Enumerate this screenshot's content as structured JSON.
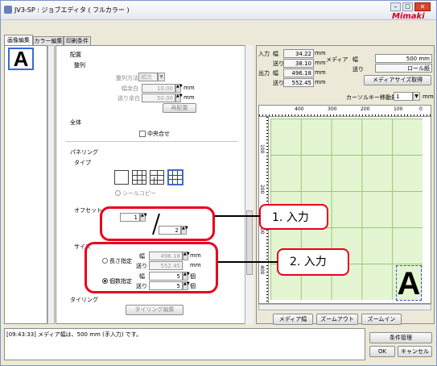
{
  "window": {
    "title": "JV3-SP : ジョブエディタ ( フルカラー )",
    "logo": "Mimaki"
  },
  "tabs": [
    "画像編集",
    "カラー編集",
    "印刷条件"
  ],
  "thumbnail_letter": "A",
  "layout": {
    "section": "配置",
    "align": "整列",
    "align_method_label": "整列方法",
    "align_method_value": "順次",
    "width_margin_label": "幅余白",
    "width_margin_value": "10.00",
    "feed_margin_label": "送り余白",
    "feed_margin_value": "50.00",
    "unit_mm": "mm",
    "rearrange": "再配置",
    "whole": "全体",
    "centering": "中央合せ"
  },
  "paneling": {
    "section": "パネリング",
    "type": "タイプ",
    "seal_copy": "シールコピー",
    "offset": "オフセット",
    "offset_value1": "1",
    "offset_value2": "2",
    "size": "サイズ",
    "length_spec": "長さ指定",
    "count_spec": "個数指定",
    "width": "幅",
    "feed": "送り",
    "length_width": "496.18",
    "length_feed": "552.45",
    "count_width": "5",
    "count_feed": "5",
    "unit_pcs": "個",
    "tiling": "タイリング",
    "tiling_edit": "タイリング編集"
  },
  "info": {
    "input": "入力",
    "output": "出力",
    "width": "幅",
    "feed": "送り",
    "in_width": "34.22",
    "in_feed": "38.10",
    "out_width": "496.18",
    "out_feed": "552.45",
    "unit": "mm",
    "media": "メディア",
    "media_width": "500 mm",
    "media_feed": "ロール紙",
    "get_media_size": "メディアサイズ取得",
    "cursor_move_label": "カーソルキー移動量",
    "cursor_move_value": "1",
    "ruler_top": [
      "400",
      "300",
      "200",
      "100",
      "0"
    ],
    "ruler_left": [
      "100",
      "200",
      "300",
      "400"
    ]
  },
  "preview_letter": "A",
  "bottom_buttons": [
    "メディア幅",
    "ズームアウト",
    "ズームイン"
  ],
  "log": "[09:43:33] メディア幅は、500 mm (手入力) です。",
  "condition_manage": "条件管理",
  "ok": "OK",
  "cancel": "キャンセル",
  "callouts": [
    "1. 入力",
    "2. 入力"
  ],
  "colors": {
    "callout": "#e8001c",
    "logo": "#d4001c",
    "preview_bg": "#e4f5d2"
  }
}
